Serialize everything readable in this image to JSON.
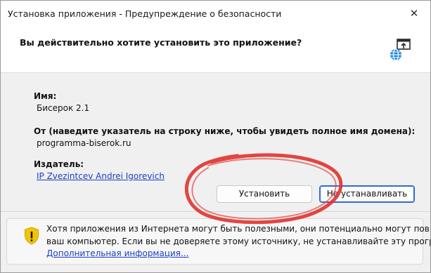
{
  "window": {
    "title": "Установка приложения - Предупреждение о безопасности",
    "close_glyph": "✕"
  },
  "header": {
    "question": "Вы действительно хотите установить это приложение?",
    "icon": "app-install-globe-icon"
  },
  "details": {
    "name_label": "Имя:",
    "name_value": "Бисерок 2.1",
    "from_label": "От (наведите указатель на строку ниже, чтобы увидеть полное имя домена):",
    "from_value": "programma-biserok.ru",
    "publisher_label": "Издатель:",
    "publisher_value": "IP Zvezintcev Andrei Igorevich"
  },
  "buttons": {
    "install": "Установить",
    "dont_install": "Не устанавливать"
  },
  "warning": {
    "icon": "shield-warning-icon",
    "line1": "Хотя приложения из Интернета могут быть полезными, они потенциально могут повредить",
    "line2": "ваш компьютер. Если вы не доверяете этому источнику, не устанавливайте эту программу.",
    "more_info": "Дополнительная информация..."
  },
  "colors": {
    "annotation_circle": "#e0322d",
    "link": "#1a3fc7",
    "default_button_border": "#2f6bd3",
    "warning_shield": "#f5c400"
  }
}
